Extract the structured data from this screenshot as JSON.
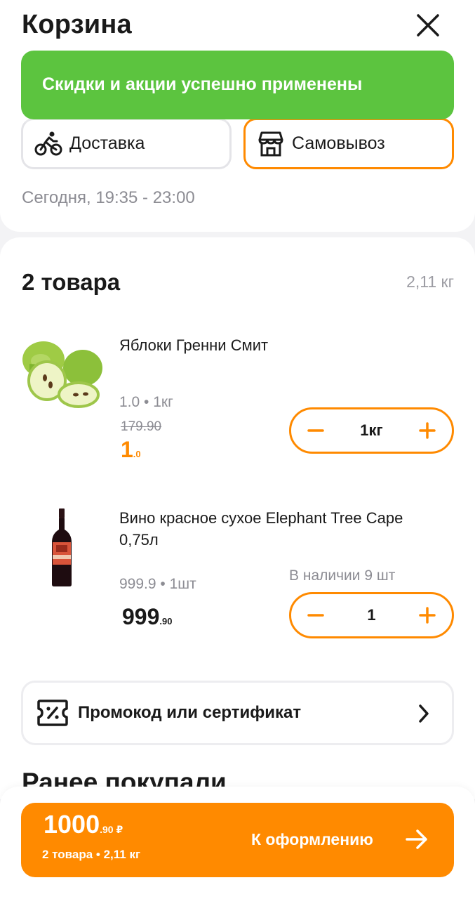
{
  "header": {
    "title": "Корзина"
  },
  "toast": {
    "text": "Скидки и акции успешно применены"
  },
  "fulfillment": {
    "delivery_label": "Доставка",
    "pickup_label": "Самовывоз",
    "selected": "pickup",
    "time": "Сегодня, 19:35 - 23:00"
  },
  "cart": {
    "title": "2 товара",
    "total_weight": "2,11 кг",
    "items": [
      {
        "name": "Яблоки Гренни Смит",
        "unit_line": "1.0 • 1кг",
        "old_price": "179.90",
        "price_main": "1",
        "price_cents": ".0",
        "quantity": "1кг"
      },
      {
        "name": "Вино красное сухое Elephant Tree Cape 0,75л",
        "unit_line": "999.9 • 1шт",
        "stock": "В наличии 9 шт",
        "price_main": "999",
        "price_cents": ".90",
        "quantity": "1"
      }
    ]
  },
  "promo": {
    "label": "Промокод или сертификат"
  },
  "previous": {
    "title": "Ранее покупали"
  },
  "checkout": {
    "total_main": "1000",
    "total_cents": ".90 ₽",
    "summary": "2 товара • 2,11 кг",
    "button_label": "К оформлению"
  },
  "colors": {
    "accent": "#ff8a00",
    "success": "#5cc43f",
    "muted": "#8c8c93"
  }
}
